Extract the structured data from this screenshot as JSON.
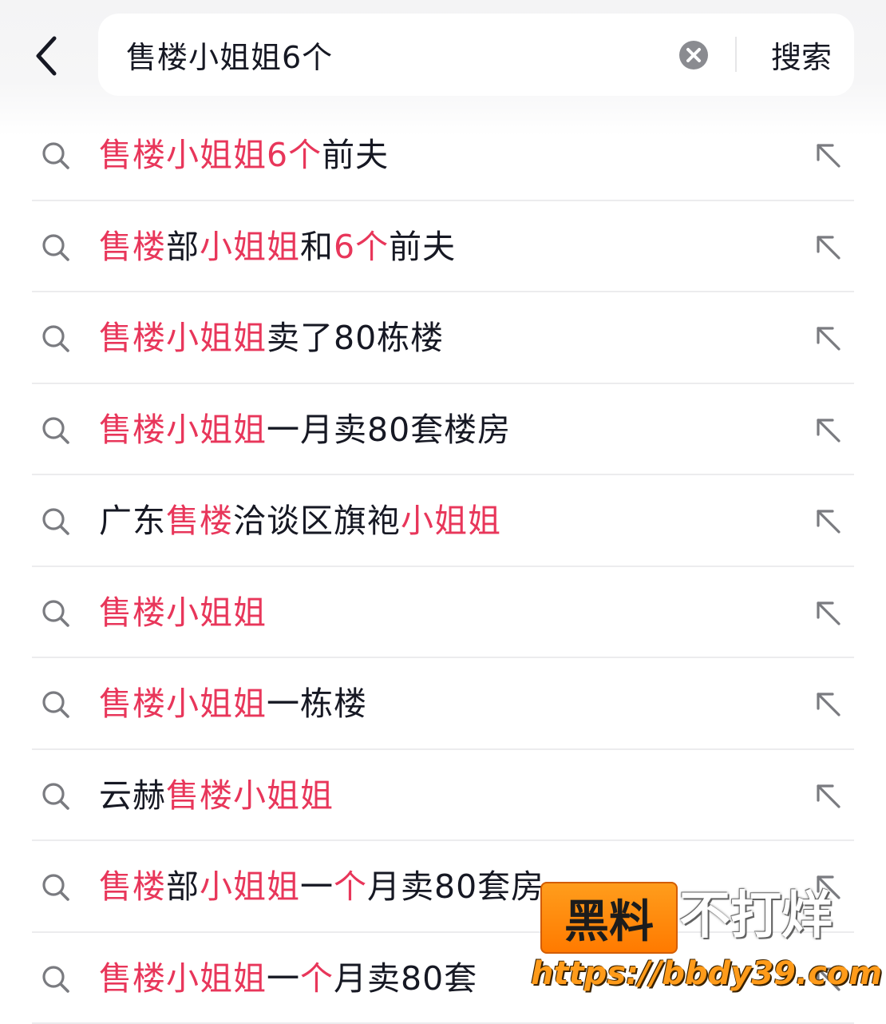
{
  "search": {
    "query": "售楼小姐姐6个",
    "submit_label": "搜索"
  },
  "colors": {
    "highlight": "#e8365a",
    "text": "#161823",
    "icon": "#7a7b80"
  },
  "icons": {
    "back": "chevron-left-icon",
    "clear": "clear-circle-icon",
    "row": "search-icon",
    "fill": "arrow-up-left-icon"
  },
  "suggestions": [
    {
      "segments": [
        {
          "text": "售楼小姐姐6个",
          "hl": true
        },
        {
          "text": "前夫",
          "hl": false
        }
      ]
    },
    {
      "segments": [
        {
          "text": "售楼",
          "hl": true
        },
        {
          "text": "部",
          "hl": false
        },
        {
          "text": "小姐姐",
          "hl": true
        },
        {
          "text": "和",
          "hl": false
        },
        {
          "text": "6个",
          "hl": true
        },
        {
          "text": "前夫",
          "hl": false
        }
      ]
    },
    {
      "segments": [
        {
          "text": "售楼小姐姐",
          "hl": true
        },
        {
          "text": "卖了80栋楼",
          "hl": false
        }
      ]
    },
    {
      "segments": [
        {
          "text": "售楼小姐姐",
          "hl": true
        },
        {
          "text": "一月卖80套楼房",
          "hl": false
        }
      ]
    },
    {
      "segments": [
        {
          "text": "广东",
          "hl": false
        },
        {
          "text": "售楼",
          "hl": true
        },
        {
          "text": "洽谈区旗袍",
          "hl": false
        },
        {
          "text": "小姐姐",
          "hl": true
        }
      ]
    },
    {
      "segments": [
        {
          "text": "售楼小姐姐",
          "hl": true
        }
      ]
    },
    {
      "segments": [
        {
          "text": "售楼小姐姐",
          "hl": true
        },
        {
          "text": "一栋楼",
          "hl": false
        }
      ]
    },
    {
      "segments": [
        {
          "text": "云赫",
          "hl": false
        },
        {
          "text": "售楼小姐姐",
          "hl": true
        }
      ]
    },
    {
      "segments": [
        {
          "text": "售楼",
          "hl": true
        },
        {
          "text": "部",
          "hl": false
        },
        {
          "text": "小姐姐",
          "hl": true
        },
        {
          "text": "一",
          "hl": false
        },
        {
          "text": "个",
          "hl": true
        },
        {
          "text": "月卖80套房",
          "hl": false
        }
      ]
    },
    {
      "segments": [
        {
          "text": "售楼小姐姐",
          "hl": true
        },
        {
          "text": "一",
          "hl": false
        },
        {
          "text": "个",
          "hl": true
        },
        {
          "text": "月卖80套",
          "hl": false
        }
      ]
    }
  ],
  "watermark": {
    "badge": "黑料",
    "side": "不打烊",
    "url": "https://bbdy39.com"
  }
}
